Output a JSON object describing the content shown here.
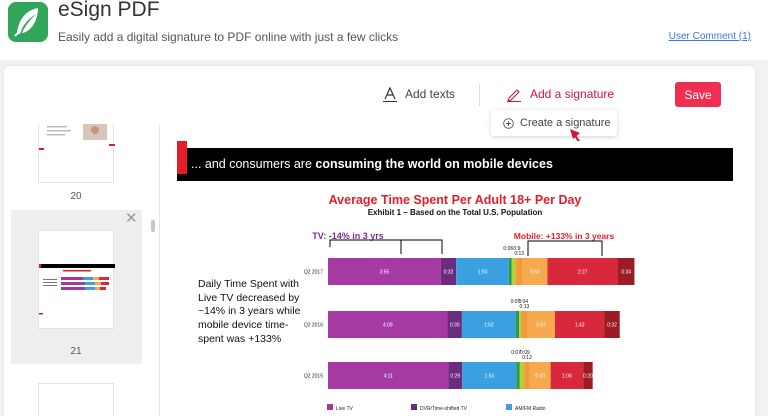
{
  "header": {
    "title": "eSign PDF",
    "subtitle": "Easily add a digital signature to PDF online with just a few clicks",
    "user_comment": "User Comment (1)"
  },
  "toolbar": {
    "add_texts": "Add texts",
    "add_signature": "Add a signature",
    "save": "Save",
    "dropdown_create": "Create a signature"
  },
  "sidebar": {
    "pages": [
      {
        "number": "20"
      },
      {
        "number": "21",
        "selected": true
      }
    ],
    "close_icon": "close-icon"
  },
  "slide": {
    "banner_prefix": "... and consumers are ",
    "banner_bold": "consuming the world on mobile devices",
    "chart_title": "Average Time Spent Per Adult 18+ Per Day",
    "chart_subtitle": "Exhibit 1 – Based on the Total U.S. Population",
    "side_text": "Daily Time Spent with Live TV decreased by ~14% in 3 years while mobile device time-spent was +133%",
    "tv_callout": "TV: -14% in 3 yrs",
    "mobile_callout": "Mobile: +133% in 3 years"
  },
  "chart_data": {
    "type": "bar",
    "orientation": "horizontal-stacked",
    "categories": [
      "Q2 2017",
      "Q2 2016",
      "Q2 2015"
    ],
    "series": [
      {
        "name": "Live TV",
        "color": "#a63aa3",
        "labels": [
          "3:55",
          "4:09",
          "4:11"
        ],
        "values": [
          3.92,
          4.15,
          4.18
        ]
      },
      {
        "name": "DVR/Time-shifted TV",
        "color": "#6b2c80",
        "labels": [
          "0:32",
          "0:30",
          "0:29"
        ],
        "values": [
          0.53,
          0.5,
          0.48
        ]
      },
      {
        "name": "AM/FM Radio",
        "color": "#3aa0e0",
        "labels": [
          "1:50",
          "1:52",
          "1:53"
        ],
        "values": [
          1.83,
          1.87,
          1.88
        ]
      },
      {
        "name": "",
        "color": "#2e9a46",
        "labels": [
          "0:06",
          "0:07",
          "0:07"
        ],
        "values": [
          0.1,
          0.12,
          0.12
        ]
      },
      {
        "name": "",
        "color": "#b5cf3a",
        "labels": [
          "0:9",
          "0:04",
          "0:09"
        ],
        "values": [
          0.15,
          0.07,
          0.15
        ]
      },
      {
        "name": "",
        "color": "#f39a38",
        "labels": [
          "0:13",
          "0:13",
          "0:12"
        ],
        "values": [
          0.22,
          0.22,
          0.2
        ]
      },
      {
        "name": "",
        "color": "#f6a94f",
        "labels": [
          "0:52",
          "0:57",
          "0:43"
        ],
        "values": [
          0.87,
          0.95,
          0.72
        ]
      },
      {
        "name": "",
        "color": "#d7283c",
        "labels": [
          "2:27",
          "1:43",
          "1:08"
        ],
        "values": [
          2.45,
          1.72,
          1.13
        ]
      },
      {
        "name": "",
        "color": "#9c1c26",
        "labels": [
          "0:34",
          "0:32",
          "0:20"
        ],
        "values": [
          0.57,
          0.53,
          0.33
        ]
      }
    ],
    "legend": [
      "Live TV",
      "DVR/Time-shifted TV",
      "AM/FM Radio"
    ]
  }
}
